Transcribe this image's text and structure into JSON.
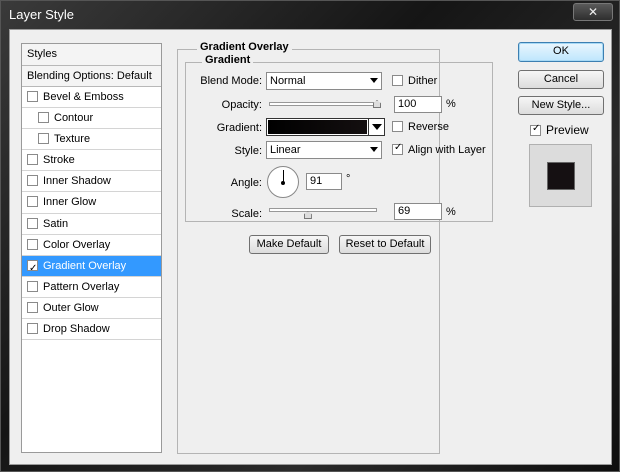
{
  "window": {
    "title": "Layer Style",
    "close_glyph": "✕"
  },
  "styles_panel": {
    "header": "Styles",
    "blending_options": "Blending Options: Default",
    "items": [
      {
        "label": "Bevel & Emboss",
        "checked": false,
        "indent": false,
        "selected": false
      },
      {
        "label": "Contour",
        "checked": false,
        "indent": true,
        "selected": false
      },
      {
        "label": "Texture",
        "checked": false,
        "indent": true,
        "selected": false
      },
      {
        "label": "Stroke",
        "checked": false,
        "indent": false,
        "selected": false
      },
      {
        "label": "Inner Shadow",
        "checked": false,
        "indent": false,
        "selected": false
      },
      {
        "label": "Inner Glow",
        "checked": false,
        "indent": false,
        "selected": false
      },
      {
        "label": "Satin",
        "checked": false,
        "indent": false,
        "selected": false
      },
      {
        "label": "Color Overlay",
        "checked": false,
        "indent": false,
        "selected": false
      },
      {
        "label": "Gradient Overlay",
        "checked": true,
        "indent": false,
        "selected": true
      },
      {
        "label": "Pattern Overlay",
        "checked": false,
        "indent": false,
        "selected": false
      },
      {
        "label": "Outer Glow",
        "checked": false,
        "indent": false,
        "selected": false
      },
      {
        "label": "Drop Shadow",
        "checked": false,
        "indent": false,
        "selected": false
      }
    ]
  },
  "gradient_overlay": {
    "section_title": "Gradient Overlay",
    "group_title": "Gradient",
    "blend_mode": {
      "label": "Blend Mode:",
      "value": "Normal"
    },
    "dither": {
      "label": "Dither",
      "checked": false
    },
    "opacity": {
      "label": "Opacity:",
      "value": "100",
      "unit": "%",
      "level": 1.0
    },
    "gradient": {
      "label": "Gradient:",
      "start_color": "#000000",
      "end_color": "#140f10"
    },
    "reverse": {
      "label": "Reverse",
      "checked": false
    },
    "style": {
      "label": "Style:",
      "value": "Linear"
    },
    "align_with_layer": {
      "label": "Align with Layer",
      "checked": true
    },
    "angle": {
      "label": "Angle:",
      "value": "91",
      "unit": "°"
    },
    "scale": {
      "label": "Scale:",
      "value": "69",
      "unit": "%",
      "level": 0.69
    },
    "make_default": "Make Default",
    "reset_to_default": "Reset to Default"
  },
  "actions": {
    "ok": "OK",
    "cancel": "Cancel",
    "new_style": "New Style...",
    "preview": {
      "label": "Preview",
      "checked": true
    },
    "preview_color": "#151012"
  },
  "colors": {
    "selection": "#3399ff",
    "dialog_bg": "#efefef"
  }
}
